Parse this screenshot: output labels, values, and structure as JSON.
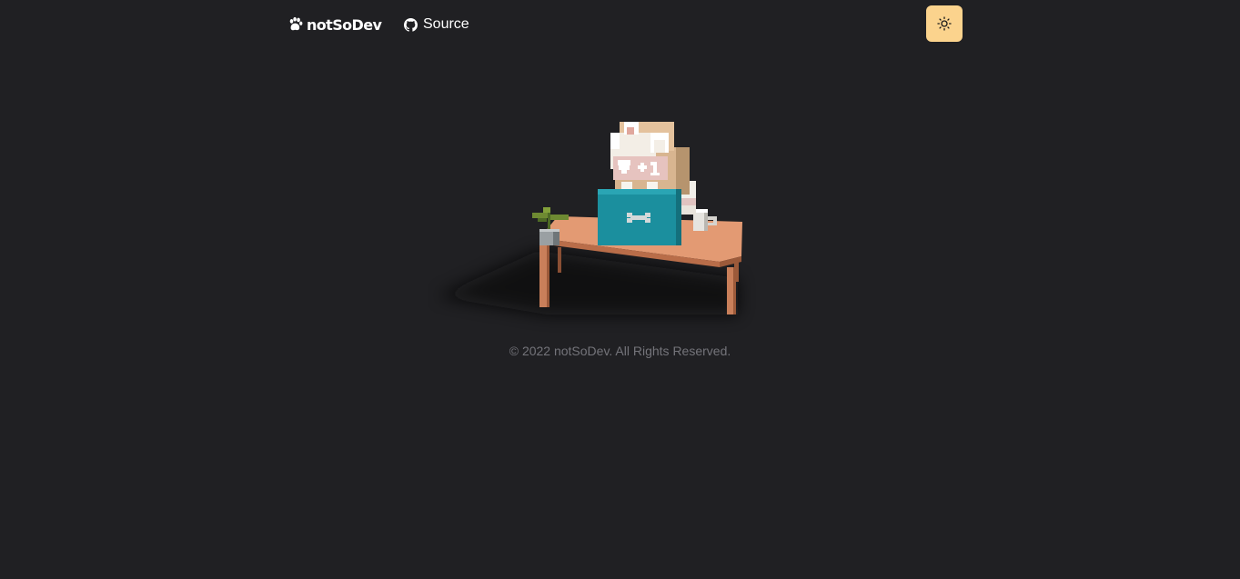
{
  "nav": {
    "brand_label": "notSoDev",
    "brand_icon": "paw-icon",
    "source_label": "Source",
    "source_icon": "github-icon",
    "theme_toggle_icon": "sun-icon"
  },
  "colors": {
    "background": "#202023",
    "theme_toggle": "#fbd38d",
    "text": "#ffffff",
    "footer_text": "#74747a"
  },
  "footer": {
    "copyright": "© 2022 notSoDev. All Rights Reserved."
  }
}
